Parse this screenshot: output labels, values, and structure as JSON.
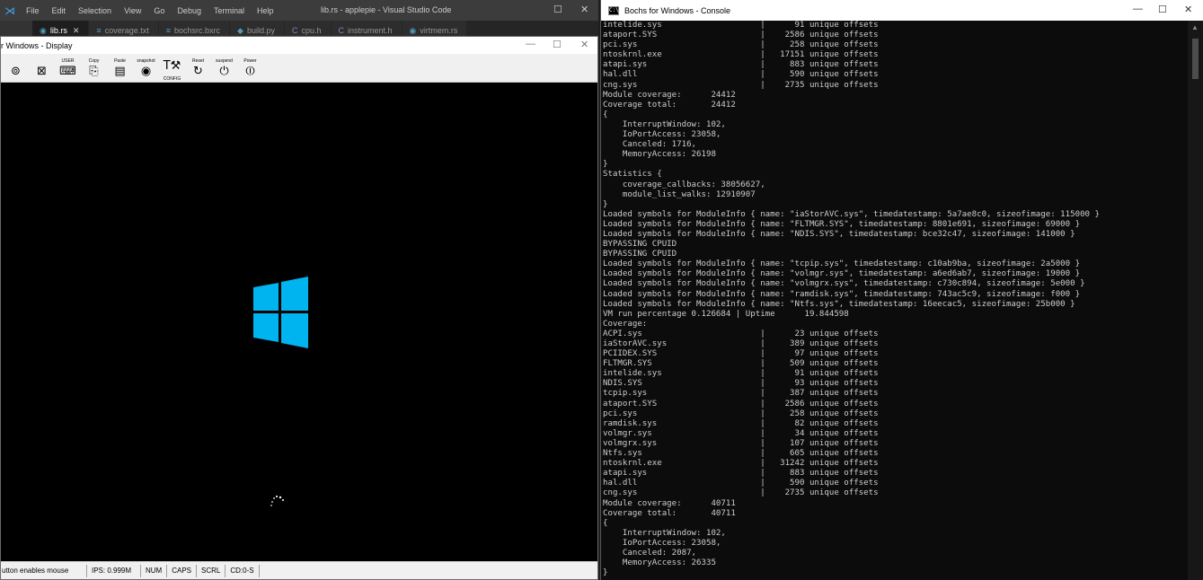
{
  "vscode": {
    "title": "lib.rs - applepie - Visual Studio Code",
    "menu": [
      "File",
      "Edit",
      "Selection",
      "View",
      "Go",
      "Debug",
      "Terminal",
      "Help"
    ],
    "tabs": [
      {
        "label": "lib.rs",
        "icon": "rust-file-icon",
        "active": true
      },
      {
        "label": "coverage.txt",
        "icon": "text-file-icon"
      },
      {
        "label": "bochsrc.bxrc",
        "icon": "config-file-icon"
      },
      {
        "label": "build.py",
        "icon": "python-file-icon"
      },
      {
        "label": "cpu.h",
        "icon": "c-header-icon"
      },
      {
        "label": "instrument.h",
        "icon": "c-header-icon"
      },
      {
        "label": "virtmem.rs",
        "icon": "rust-file-icon"
      }
    ]
  },
  "bochs": {
    "title": "r Windows - Display",
    "toolbar": [
      {
        "label": "",
        "glyph": "⊚",
        "icon": "cdrom-icon"
      },
      {
        "label": "",
        "glyph": "⊠",
        "icon": "mouse-icon"
      },
      {
        "label": "USER",
        "glyph": "⌨",
        "icon": "user-icon"
      },
      {
        "label": "Copy",
        "glyph": "⎘",
        "icon": "copy-icon"
      },
      {
        "label": "Paste",
        "glyph": "▤",
        "icon": "paste-icon"
      },
      {
        "label": "snapshot",
        "glyph": "◉",
        "icon": "snapshot-icon"
      },
      {
        "label": "CONFIG",
        "glyph": "T⚒",
        "icon": "config-icon"
      },
      {
        "label": "Reset",
        "glyph": "↻",
        "icon": "reset-icon"
      },
      {
        "label": "suspend",
        "glyph": "⏻",
        "icon": "suspend-icon"
      },
      {
        "label": "Power",
        "glyph": "⏼",
        "icon": "power-icon"
      }
    ],
    "status": [
      "utton enables mouse",
      "IPS: 0.999M",
      "NUM",
      "CAPS",
      "SCRL",
      "CD:0-S"
    ],
    "logo_color": "#00b4f0"
  },
  "console": {
    "title": "Bochs for Windows - Console",
    "lines": [
      "intelide.sys                    |      91 unique offsets",
      "ataport.SYS                     |    2586 unique offsets",
      "pci.sys                         |     258 unique offsets",
      "ntoskrnl.exe                    |   17151 unique offsets",
      "atapi.sys                       |     883 unique offsets",
      "hal.dll                         |     590 unique offsets",
      "cng.sys                         |    2735 unique offsets",
      "Module coverage:      24412",
      "Coverage total:       24412",
      "{",
      "    InterruptWindow: 102,",
      "    IoPortAccess: 23058,",
      "    Canceled: 1716,",
      "    MemoryAccess: 26198",
      "}",
      "Statistics {",
      "    coverage_callbacks: 38056627,",
      "    module_list_walks: 12910907",
      "}",
      "Loaded symbols for ModuleInfo { name: \"iaStorAVC.sys\", timedatestamp: 5a7ae8c0, sizeofimage: 115000 }",
      "Loaded symbols for ModuleInfo { name: \"FLTMGR.SYS\", timedatestamp: 8801e691, sizeofimage: 69000 }",
      "Loaded symbols for ModuleInfo { name: \"NDIS.SYS\", timedatestamp: bce32c47, sizeofimage: 141000 }",
      "BYPASSING CPUID",
      "BYPASSING CPUID",
      "Loaded symbols for ModuleInfo { name: \"tcpip.sys\", timedatestamp: c10ab9ba, sizeofimage: 2a5000 }",
      "Loaded symbols for ModuleInfo { name: \"volmgr.sys\", timedatestamp: a6ed6ab7, sizeofimage: 19000 }",
      "Loaded symbols for ModuleInfo { name: \"volmgrx.sys\", timedatestamp: c730c894, sizeofimage: 5e000 }",
      "Loaded symbols for ModuleInfo { name: \"ramdisk.sys\", timedatestamp: 743ac5c9, sizeofimage: f000 }",
      "Loaded symbols for ModuleInfo { name: \"Ntfs.sys\", timedatestamp: 16eecac5, sizeofimage: 25b000 }",
      "VM run percentage 0.126684 | Uptime      19.844598",
      "Coverage:",
      "ACPI.sys                        |      23 unique offsets",
      "iaStorAVC.sys                   |     389 unique offsets",
      "PCIIDEX.SYS                     |      97 unique offsets",
      "FLTMGR.SYS                      |     509 unique offsets",
      "intelide.sys                    |      91 unique offsets",
      "NDIS.SYS                        |      93 unique offsets",
      "tcpip.sys                       |     387 unique offsets",
      "ataport.SYS                     |    2586 unique offsets",
      "pci.sys                         |     258 unique offsets",
      "ramdisk.sys                     |      82 unique offsets",
      "volmgr.sys                      |      34 unique offsets",
      "volmgrx.sys                     |     107 unique offsets",
      "Ntfs.sys                        |     605 unique offsets",
      "ntoskrnl.exe                    |   31242 unique offsets",
      "atapi.sys                       |     883 unique offsets",
      "hal.dll                         |     590 unique offsets",
      "cng.sys                         |    2735 unique offsets",
      "Module coverage:      40711",
      "Coverage total:       40711",
      "{",
      "    InterruptWindow: 102,",
      "    IoPortAccess: 23058,",
      "    Canceled: 2087,",
      "    MemoryAccess: 26335",
      "}"
    ]
  }
}
